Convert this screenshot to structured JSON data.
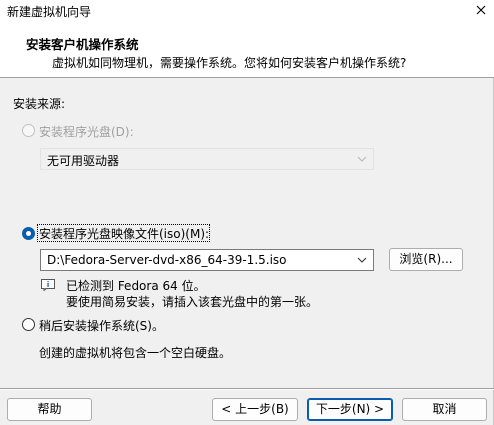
{
  "window": {
    "title": "新建虚拟机向导"
  },
  "header": {
    "title": "安装客户机操作系统",
    "subtitle": "虚拟机如同物理机，需要操作系统。您将如何安装客户机操作系统?"
  },
  "source": {
    "group_label": "安装来源:",
    "disc_option": {
      "label": "安装程序光盘(D):",
      "selected": false,
      "enabled": false,
      "drive_value": "无可用驱动器"
    },
    "iso_option": {
      "label": "安装程序光盘映像文件(iso)(M):",
      "selected": true,
      "enabled": true,
      "path_value": "D:\\Fedora-Server-dvd-x86_64-39-1.5.iso",
      "browse_label": "浏览(R)...",
      "detect_line1": "已检测到 Fedora 64 位。",
      "detect_line2": "要使用简易安装，请插入该套光盘中的第一张。"
    },
    "later_option": {
      "label": "稍后安装操作系统(S)。",
      "selected": false,
      "enabled": true,
      "description": "创建的虚拟机将包含一个空白硬盘。"
    }
  },
  "footer": {
    "help_label": "帮助",
    "back_label": "< 上一步(B)",
    "next_label": "下一步(N) >",
    "cancel_label": "取消"
  },
  "colors": {
    "accent": "#0b5cad",
    "disabled_text": "#a0a0a0",
    "background": "#f0f0f0"
  }
}
